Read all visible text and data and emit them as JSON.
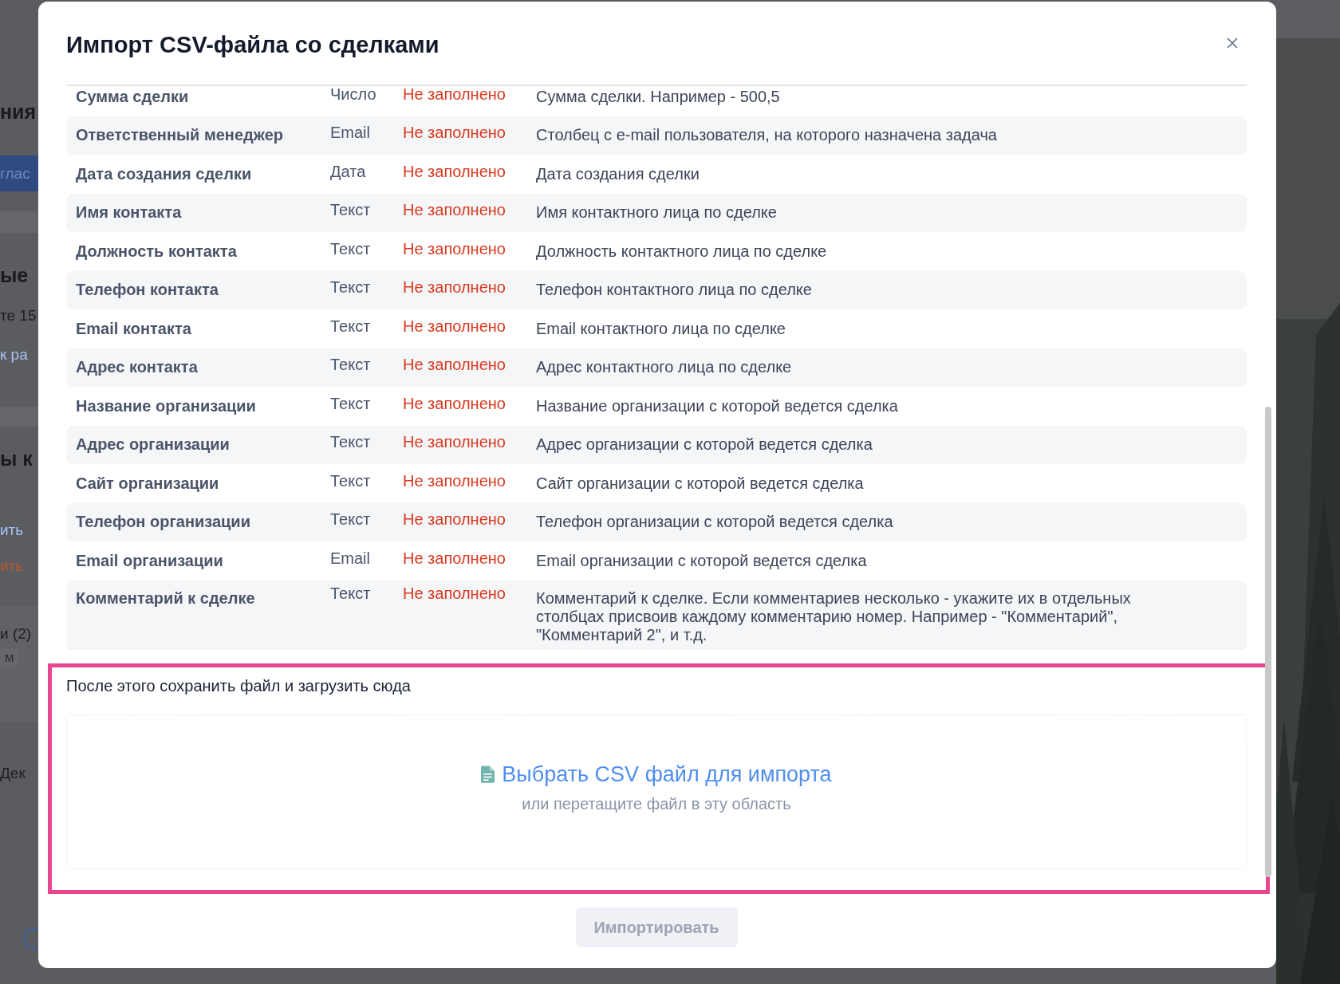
{
  "background": {
    "fragments": [
      {
        "kind": "heading",
        "text": "ния"
      },
      {
        "kind": "button",
        "text": "глас"
      },
      {
        "kind": "heading",
        "text": "ые"
      },
      {
        "kind": "text",
        "text": "те 15"
      },
      {
        "kind": "link",
        "text": "к ра"
      },
      {
        "kind": "heading",
        "text": "ы к"
      },
      {
        "kind": "link",
        "text": "ить"
      },
      {
        "kind": "warn-link",
        "text": "ить"
      },
      {
        "kind": "text",
        "text": "и (2)"
      },
      {
        "kind": "badge",
        "text": "м"
      },
      {
        "kind": "text",
        "text": "Дек"
      }
    ]
  },
  "dialog": {
    "title": "Импорт CSV-файла со сделками",
    "fields": [
      {
        "name": "Сумма сделки",
        "type": "Число",
        "status": "Не заполнено",
        "description": "Сумма сделки. Например - 500,5"
      },
      {
        "name": "Ответственный менеджер",
        "type": "Email",
        "status": "Не заполнено",
        "description": "Столбец с e-mail пользователя, на которого назначена задача"
      },
      {
        "name": "Дата создания сделки",
        "type": "Дата",
        "status": "Не заполнено",
        "description": "Дата создания сделки"
      },
      {
        "name": "Имя контакта",
        "type": "Текст",
        "status": "Не заполнено",
        "description": "Имя контактного лица по сделке"
      },
      {
        "name": "Должность контакта",
        "type": "Текст",
        "status": "Не заполнено",
        "description": "Должность контактного лица по сделке"
      },
      {
        "name": "Телефон контакта",
        "type": "Текст",
        "status": "Не заполнено",
        "description": "Телефон контактного лица по сделке"
      },
      {
        "name": "Email контакта",
        "type": "Текст",
        "status": "Не заполнено",
        "description": "Email контактного лица по сделке"
      },
      {
        "name": "Адрес контакта",
        "type": "Текст",
        "status": "Не заполнено",
        "description": "Адрес контактного лица по сделке"
      },
      {
        "name": "Название организации",
        "type": "Текст",
        "status": "Не заполнено",
        "description": "Название организации с которой ведется сделка"
      },
      {
        "name": "Адрес организации",
        "type": "Текст",
        "status": "Не заполнено",
        "description": "Адрес организации с которой ведется сделка"
      },
      {
        "name": "Сайт организации",
        "type": "Текст",
        "status": "Не заполнено",
        "description": "Сайт организации с которой ведется сделка"
      },
      {
        "name": "Телефон организации",
        "type": "Текст",
        "status": "Не заполнено",
        "description": "Телефон организации с которой ведется сделка"
      },
      {
        "name": "Email организации",
        "type": "Email",
        "status": "Не заполнено",
        "description": "Email организации с которой ведется сделка"
      },
      {
        "name": "Комментарий к сделке",
        "type": "Текст",
        "status": "Не заполнено",
        "description": "Комментарий к сделке. Если комментариев несколько - укажите их в отдельных столбцах присвоив каждому комментарию номер. Например - \"Комментарий\", \"Комментарий 2\", и т.д."
      }
    ],
    "upload": {
      "instruction": "После этого сохранить файл и загрузить сюда",
      "link": "Выбрать CSV файл для импорта",
      "hint": "или перетащите файл в эту область"
    },
    "import_button": {
      "label": "Импортировать",
      "disabled": true
    }
  }
}
